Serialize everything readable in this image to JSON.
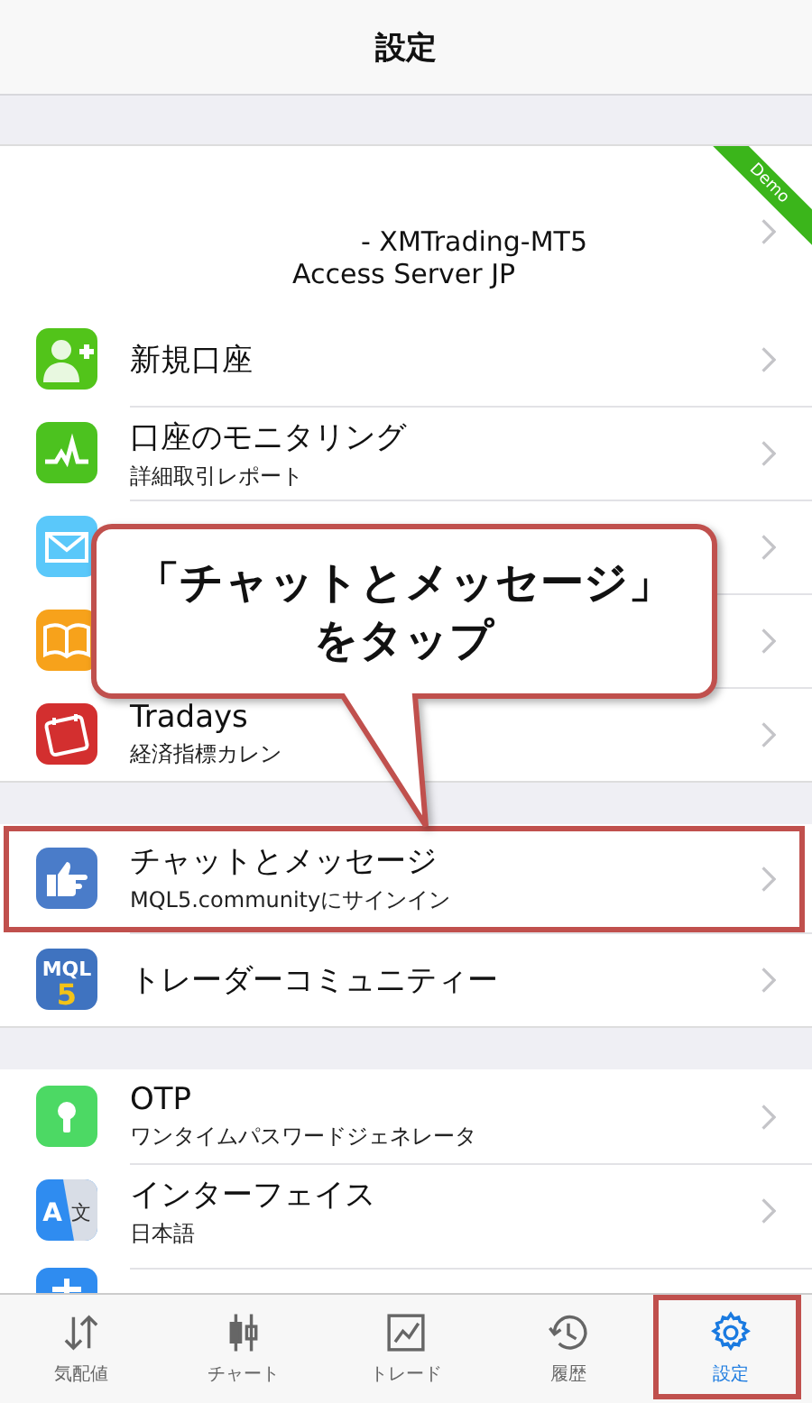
{
  "header": {
    "title": "設定"
  },
  "account": {
    "line_1": "- XMTrading-MT5",
    "line_2": "Access Server JP",
    "ribbon": "Demo"
  },
  "sections": [
    {
      "items": [
        {
          "kind": "person-add",
          "title": "新規口座",
          "highlighted": false
        },
        {
          "kind": "pulse",
          "title": "口座のモニタリング",
          "subtitle": "詳細取引レポート",
          "highlighted": false
        },
        {
          "kind": "mail",
          "highlighted": false
        },
        {
          "kind": "book",
          "highlighted": false
        },
        {
          "kind": "calendar",
          "title": "Tradays",
          "subtitle": "経済指標カレン",
          "highlighted": false
        }
      ]
    },
    {
      "items": [
        {
          "kind": "hand",
          "title": "チャットとメッセージ",
          "subtitle": "MQL5.communityにサインイン",
          "highlighted": true
        },
        {
          "kind": "mql",
          "icon_text": [
            "MQL",
            "5"
          ],
          "title": "トレーダーコミュニティー",
          "highlighted": false
        }
      ]
    },
    {
      "items": [
        {
          "kind": "keyhole",
          "title": "OTP",
          "subtitle": "ワンタイムパスワードジェネレータ",
          "highlighted": false
        },
        {
          "kind": "translate",
          "icon_text": [
            "A",
            "文"
          ],
          "title": "インターフェイス",
          "subtitle": "日本語",
          "highlighted": false
        },
        {
          "kind": "partial",
          "highlighted": false
        }
      ]
    }
  ],
  "callout": {
    "lines": [
      "「チャットとメッセージ」",
      "をタップ"
    ]
  },
  "tabs": [
    {
      "kind": "arrows",
      "label": "気配値",
      "selected": false,
      "highlighted": false
    },
    {
      "kind": "candles",
      "label": "チャート",
      "selected": false,
      "highlighted": false
    },
    {
      "kind": "trade",
      "label": "トレード",
      "selected": false,
      "highlighted": false
    },
    {
      "kind": "history",
      "label": "履歴",
      "selected": false,
      "highlighted": false
    },
    {
      "kind": "gear",
      "label": "設定",
      "selected": true,
      "highlighted": true
    }
  ]
}
